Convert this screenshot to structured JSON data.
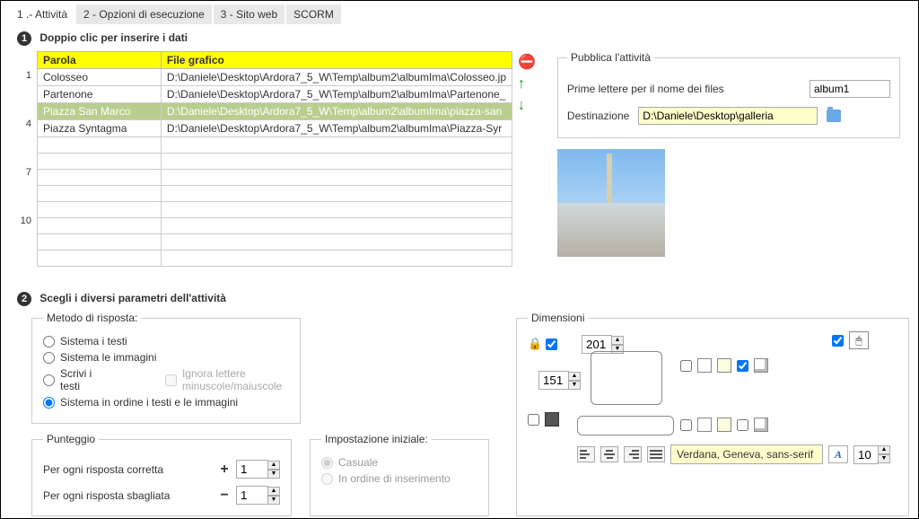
{
  "tabs": {
    "t1": "1 .- Attività",
    "t2": "2 - Opzioni di esecuzione",
    "t3": "3 - Sito web",
    "t4": "SCORM"
  },
  "step1": {
    "title": "Doppio clic per inserire i dati"
  },
  "table": {
    "headers": {
      "h1": "Parola",
      "h2": "File grafico"
    },
    "rows": [
      {
        "idx": "1",
        "word": "Colosseo",
        "file": "D:\\Daniele\\Desktop\\Ardora7_5_W\\Temp\\album2\\albumIma\\Colosseo.jp"
      },
      {
        "idx": "",
        "word": "Partenone",
        "file": "D:\\Daniele\\Desktop\\Ardora7_5_W\\Temp\\album2\\albumIma\\Partenone_"
      },
      {
        "idx": "",
        "word": "Piazza San Marco",
        "file": "D:\\Daniele\\Desktop\\Ardora7_5_W\\Temp\\album2\\albumIma\\piazza-san",
        "selected": true
      },
      {
        "idx": "4",
        "word": "Piazza Syntagma",
        "file": "D:\\Daniele\\Desktop\\Ardora7_5_W\\Temp\\album2\\albumIma\\Piazza-Syr"
      },
      {
        "idx": "",
        "word": "",
        "file": ""
      },
      {
        "idx": "",
        "word": "",
        "file": ""
      },
      {
        "idx": "7",
        "word": "",
        "file": ""
      },
      {
        "idx": "",
        "word": "",
        "file": ""
      },
      {
        "idx": "",
        "word": "",
        "file": ""
      },
      {
        "idx": "10",
        "word": "",
        "file": ""
      },
      {
        "idx": "",
        "word": "",
        "file": ""
      },
      {
        "idx": "",
        "word": "",
        "file": ""
      }
    ]
  },
  "publish": {
    "legend": "Pubblica l'attività",
    "prefix_label": "Prime lettere per il nome dei files",
    "prefix_value": "album1",
    "dest_label": "Destinazione",
    "dest_value": "D:\\Daniele\\Desktop\\galleria"
  },
  "step2": {
    "title": "Scegli i diversi parametri dell'attività"
  },
  "method": {
    "legend": "Metodo di risposta:",
    "r1": "Sistema i testi",
    "r2": "Sistema le immagini",
    "r3": "Scrivi i testi",
    "r4": "Sistema in ordine i testi e le immagini",
    "ignore": "Ignora lettere minuscole/maiuscole"
  },
  "score": {
    "legend": "Punteggio",
    "correct": "Per ogni risposta corretta",
    "wrong": "Per ogni risposta sbagliata",
    "correct_val": "1",
    "wrong_val": "1",
    "plus": "+",
    "minus": "−"
  },
  "init": {
    "legend": "Impostazione iniziale:",
    "r1": "Casuale",
    "r2": "In ordine di inserimento"
  },
  "dim": {
    "legend": "Dimensioni",
    "w": "201",
    "h": "151",
    "font_family": "Verdana, Geneva, sans-serif",
    "font_size": "10"
  }
}
